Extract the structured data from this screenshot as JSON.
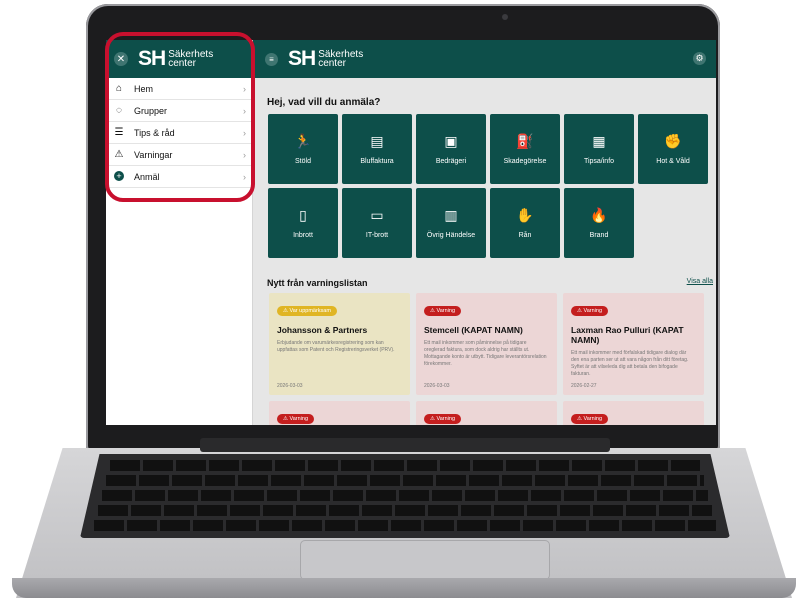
{
  "app": {
    "logo_mark": "SH",
    "logo_text_1": "Säkerhets",
    "logo_text_2": "center"
  },
  "sidebar": {
    "items": [
      {
        "label": "Hem",
        "icon": "home-icon"
      },
      {
        "label": "Grupper",
        "icon": "groups-icon"
      },
      {
        "label": "Tips & råd",
        "icon": "list-icon"
      },
      {
        "label": "Varningar",
        "icon": "warning-icon"
      },
      {
        "label": "Anmäl",
        "icon": "plus-icon"
      }
    ]
  },
  "main": {
    "greeting": "Hej, vad vill du anmäla?",
    "tiles": [
      {
        "label": "Stöld",
        "icon": "running-thief-icon"
      },
      {
        "label": "Bluffaktura",
        "icon": "invoice-icon"
      },
      {
        "label": "Bedrägeri",
        "icon": "card-screen-icon"
      },
      {
        "label": "Skadegörelse",
        "icon": "spray-can-icon"
      },
      {
        "label": "Tipsa/info",
        "icon": "info-board-icon"
      },
      {
        "label": "Hot & Våld",
        "icon": "violence-icon"
      },
      {
        "label": "Inbrott",
        "icon": "door-break-icon"
      },
      {
        "label": "IT-brott",
        "icon": "computer-icon"
      },
      {
        "label": "Övrig Händelse",
        "icon": "event-board-icon"
      },
      {
        "label": "Rån",
        "icon": "robbery-icon"
      },
      {
        "label": "Brand",
        "icon": "fire-icon"
      }
    ],
    "news_heading": "Nytt från varningslistan",
    "visa_alla": "Visa alla",
    "cards": [
      {
        "badge": "Var uppmärksam",
        "title": "Johansson & Partners",
        "desc": "Erbjudande om varumärkesregistrering som kan uppfattas som Patent och Registreringsverket (PRV).",
        "date": "2026-03-03"
      },
      {
        "badge": "Varning",
        "title": "Stemcell (KAPAT NAMN)",
        "desc": "Ett mail inkommer som påminnelse på tidigare oreglerad faktura, som dock aldrig har ställts ut. Mottagande konto är utbytt. Tidigare leverantörsrelation förekommer.",
        "date": "2026-03-03"
      },
      {
        "badge": "Varning",
        "title": "Laxman Rao Pulluri (KAPAT NAMN)",
        "desc": "Ett mail inkommer med förfalskad tidigare dialog där den ena parten ser ut att vara någon från ditt företag. Syftet är att vilseleda dig att betala den bifogade fakturan.",
        "date": "2026-02-27"
      },
      {
        "badge": "Varning"
      },
      {
        "badge": "Varning"
      },
      {
        "badge": "Varning"
      }
    ]
  },
  "colors": {
    "brand": "#0d4f4a",
    "warning_red": "#c41e1e",
    "attention_yellow": "#e0b524",
    "highlight_red": "#c8102e"
  }
}
